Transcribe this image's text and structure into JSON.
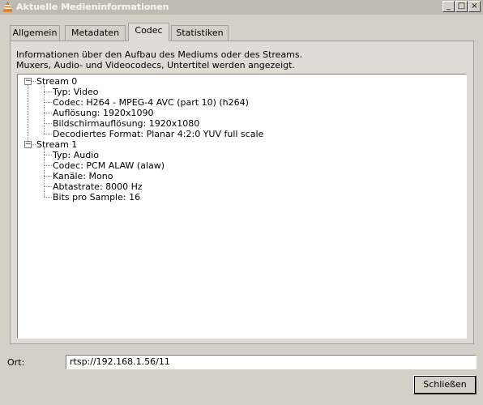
{
  "window": {
    "title": "Aktuelle Medieninformationen",
    "minimize": "_",
    "maximize": "□",
    "close": "×"
  },
  "tabs": [
    {
      "label": "Allgemein",
      "active": false
    },
    {
      "label": "Metadaten",
      "active": false
    },
    {
      "label": "Codec",
      "active": true
    },
    {
      "label": "Statistiken",
      "active": false
    }
  ],
  "info_text": {
    "line1": "Informationen über den Aufbau des Mediums oder des Streams.",
    "line2": "Muxers, Audio- und Videocodecs, Untertitel werden angezeigt."
  },
  "tree": {
    "streams": [
      {
        "label": "Stream 0",
        "expanded": true,
        "items": [
          "Typ: Video",
          "Codec: H264 - MPEG-4 AVC (part 10) (h264)",
          "Auflösung: 1920x1090",
          "Bildschirmauflösung: 1920x1080",
          "Decodiertes Format: Planar 4:2:0 YUV full scale"
        ]
      },
      {
        "label": "Stream 1",
        "expanded": true,
        "items": [
          "Typ: Audio",
          "Codec: PCM ALAW (alaw)",
          "Kanäle: Mono",
          "Abtastrate: 8000 Hz",
          "Bits pro Sample: 16"
        ]
      }
    ]
  },
  "location": {
    "label": "Ort:",
    "value": "rtsp://192.168.1.56/11"
  },
  "buttons": {
    "close_label": "Schließen"
  }
}
